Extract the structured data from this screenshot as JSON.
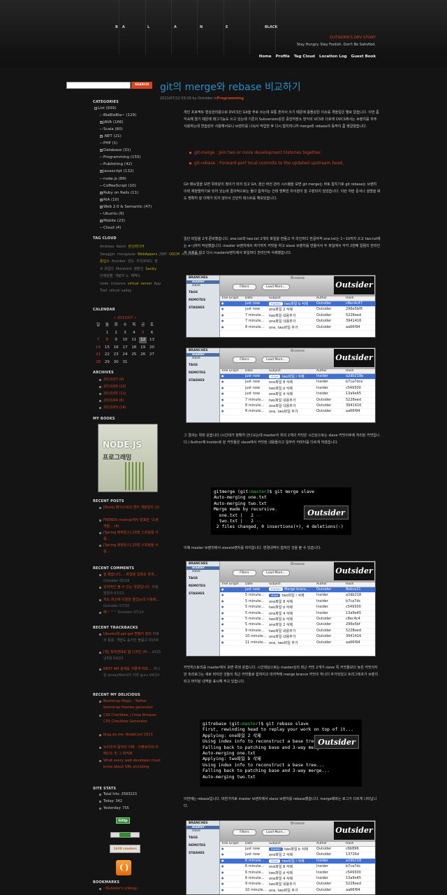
{
  "header": {
    "letters": [
      "B",
      "A",
      "L",
      "A",
      "N",
      "C",
      "E",
      "BLACK"
    ],
    "tagline_title": "OUTSIDER'S DEV STORY",
    "tagline_sub": "Stay Hungry. Stay Foolish. Don't Be Satisfied.",
    "nav": [
      "Home",
      "Profile",
      "Tag Cloud",
      "Location Log",
      "Guest Book"
    ]
  },
  "search": {
    "button": "SEARCH",
    "value": ""
  },
  "sidebar": {
    "categories_title": "CATEGORIES",
    "categories": [
      {
        "label": "List (939)",
        "toggle": "-"
      },
      {
        "label": "BlaBlaBla~ (129)"
      },
      {
        "label": "JAVA (166)",
        "toggle": "+"
      },
      {
        "label": "Scala (60)"
      },
      {
        "label": ".NET (21)",
        "toggle": "+"
      },
      {
        "label": "PHP (1)"
      },
      {
        "label": "Database (31)",
        "toggle": "+"
      },
      {
        "label": "Programming (155)"
      },
      {
        "label": "Publishing (42)"
      },
      {
        "label": "Javascript (132)",
        "toggle": "+"
      },
      {
        "label": "node.js (89)"
      },
      {
        "label": "CoffeeScript (10)"
      },
      {
        "label": "Ruby on Rails (11)",
        "toggle": "+"
      },
      {
        "label": "RIA (10)",
        "toggle": "+"
      },
      {
        "label": "Web 2.0 & Semantic (47)",
        "toggle": "+"
      },
      {
        "label": "Ubuntu (6)"
      },
      {
        "label": "Mobile (23)",
        "toggle": "+"
      },
      {
        "label": "Cloud (4)"
      }
    ],
    "tagcloud_title": "TAG CLOUD",
    "tags": [
      {
        "t": "Andreas"
      },
      {
        "t": "Katch"
      },
      {
        "t": "런닝머디어",
        "h": 1
      },
      {
        "t": "Swagger"
      },
      {
        "t": "mongoose"
      },
      {
        "t": "WebAppers",
        "h": 1
      },
      {
        "t": "JSEP"
      },
      {
        "t": "OSCM",
        "h": 1
      },
      {
        "t": "Accelerator"
      },
      {
        "t": "틀딥스",
        "h": 1
      },
      {
        "t": "Number"
      },
      {
        "t": "언도"
      },
      {
        "t": "우리코덕드"
      },
      {
        "t": "장수 유입다"
      },
      {
        "t": "MoreUnit"
      },
      {
        "t": "정환인"
      },
      {
        "t": "Sanity",
        "h": 1
      },
      {
        "t": "단례원별"
      },
      {
        "t": "개발자 노"
      },
      {
        "t": "해맥드"
      },
      {
        "t": "node"
      },
      {
        "t": "instance"
      },
      {
        "t": "virtual",
        "h": 1
      },
      {
        "t": "server",
        "h": 1
      },
      {
        "t": "App Trail"
      },
      {
        "t": "silicon valley"
      }
    ],
    "calendar_title": "CALENDAR",
    "calendar_month": "« 2013/07 »",
    "calendar_days": [
      "일",
      "월",
      "화",
      "수",
      "목",
      "금",
      "토"
    ],
    "calendar_rows": [
      [
        "",
        "1",
        "2",
        "3",
        "4",
        "5",
        "6"
      ],
      [
        "7",
        "8",
        "9",
        "10",
        "11",
        "12",
        "13"
      ],
      [
        "14",
        "15",
        "16",
        "17",
        "18",
        "19",
        "20"
      ],
      [
        "21",
        "22",
        "23",
        "24",
        "25",
        "26",
        "27"
      ],
      [
        "28",
        "29",
        "30",
        "31",
        "",
        "",
        ""
      ]
    ],
    "archives_title": "ARCHIVES",
    "archives": [
      "2013/07 (4)",
      "2013/06 (10)",
      "2013/05 (11)",
      "2013/04 (8)",
      "2013/03 (14)"
    ],
    "book_title": "MY BOOKS",
    "book_cover": {
      "title": "NODE.JS",
      "subtitle": "프로그래밍"
    },
    "recent_posts_title": "RECENT POSTS",
    "recent_posts": [
      "[Book] 페이스북의 엔지 개발일지 (2)",
      "FRENDS meetup에서 발표한 \"소셜 개발... (4)",
      "[Spring 레퍼런스] 20장 스프링을 사용...",
      "[Spring 레퍼런스] 20장 스프링을 사용..."
    ],
    "recent_comments_title": "RECENT COMMENTS",
    "recent_comments": [
      {
        "t": "잘 봤습니다.... 파일을 압축도 한개...",
        "s": "Outsider 05/18"
      },
      {
        "t": "관리자만 볼 수 있는 댓글입니다.",
        "s": "비밀방문자 07/11"
      },
      {
        "t": "저도 최근에 이끌한 들었는데 이북에...",
        "s": "Outsider 07/10"
      },
      {
        "t": "예~ ^^",
        "s": "Outsider 07/10"
      }
    ],
    "recent_trackbacks_title": "RECENT TRACKBACKS",
    "recent_trackbacks": [
      {
        "t": "Ubuntu에 apt-get 명령어 정리",
        "s": "자료와 등용. 개발도 숨겨진 볼품고 03/06"
      },
      {
        "t": "[책] 피처엔대로 웹 디자인 (Pr...",
        "s": "2020년8월 04/22"
      },
      {
        "t": "REST API 설계를 어떻게 하죠 ...",
        "s": "하나된 jerseyWorld의 자바 guru 04/10"
      }
    ],
    "recent_delicious_title": "RECENT MY DELICIOUS",
    "recent_delicious": [
      "Bootstrap Magic : Twitter bootstrap themes generator",
      "CSS Checkbox | Cross Browser CSS Checkbox Generator",
      "blog.izs.me: NodeConf 2013",
      "브라우저 동작의 이해 - 이플로우와 리페인드 및 그 최적화",
      "What every web developer must know about URL encoding"
    ],
    "site_stats_title": "SITE STATS",
    "site_stats": [
      "Total hits: 2583223",
      "Today: 342",
      "Yesterday: 755"
    ],
    "badges": [
      "Gitip",
      "1620 readers"
    ],
    "bookmarks_title": "BOOKMARKS",
    "bookmarks": [
      "::Outsider's Lifelog::"
    ]
  },
  "post": {
    "title": "git의 merge와 rebase 비교하기",
    "meta_prefix": "2011/07/12 03:29 by Outsider in",
    "meta_category": "Programming",
    "p1": "개인 프로젝트 형상관리용으로 DVCS인 Git을 주로 쓰는데 보통 혼자서 쓰기 때문에 충돌같은 이슈를 겪을일은 별로 없습니다. 이번 좀 익숙해 졌기 때문에 태그기능도 쓰고 있는데 기존의 Subversion같은 중앙저장소 방식의 VCS와 다르게 DVCS에서는 브랜치를 자주 사용하는데 연습삼아 사용해서보니 브랜치를 나눠서 작업한 후 다시 합치려니까 merge와 rebase의 동작이 좀 햇갈렸습니다.",
    "list": [
      "git-merge : Join two or more development histories together.",
      "git-rebase : Forward-port local commits to the updated upstream head."
    ],
    "p2": "Git 매뉴얼을 보면 위와같이 정의가 되어 있고 Git, 분산 버전 관리 시스템을 보면 git merge는 바로 합치기로 git rebase는 브랜치 이력 재정렬하기로 되어 있는데 결과적으로는 둘다 합쳐지는 건데 명확한 차이점이 잘 구분되지 않았습니다. 이런 저런 문서나 설명을 봐도 명확히 잘 이해가 되지 않아서 간단히 테스트를 해보았습니다.",
    "p3": "일단 파일을 2개 준비했습니다. one.txt와 two.txt 2개의 파일을 만들고 각 라인마다 한글자씩 one.txt는 1~10까지 쓰고 two.txt에는 a~j까지 작성했습니다. master 브랜치에서 여기까지 커밋을 하고 slave 브랜치를 만들어서 두 파일에서 각각 2번째 칼럼의 한라인씩 삭제를 하고 다시 master브랜치에서 파일마다 한라인씩 삭제했습니다.",
    "p4": "그 결과는 위와 같습니다.(시간대가 정확히 안나오는데 master의 위의 2개의 커밋은 시간순으로는 slave 커밋이후에 처리된 커밋입니다.) Author에 Insider로 된 커밋들은 slave에서 커밋된 내용들이고 일부러 커미터를 다르게 하였습니다.",
    "p5": "이제 master 브랜치에서 slave브랜치를 머지합니다. 변경내역이 합쳐진 것을 볼 수 있습니다.",
    "p6": "커밋히스토리를 master에서 보면 위와 같습니다. 시간대상으로는 master상의 최근 커밋 2개가 slave 쪽 커밋들보다 늦은 커밋이지만 트리로그는 새로 머지한 것들이 최근 커밋들로 합쳐지고 마지막에 merge brance 커밋이 하나더 추가되었고 트리그래프가 브랜치되고 머지된 내역을 표시해 주고 있습니다.",
    "p7": "이번에는 rebase입니다. 마찬가지로 master 브랜치에서 slave 브랜치를 rebase했습니다. merge때와는 로그가 다르게 나타납니다.",
    "gitx": {
      "title": "Browse",
      "filters": "Filters",
      "loadmore": "Load More...",
      "logo": "Outsider",
      "branches": "BRANCHES",
      "tags": "TAGS",
      "remotes": "REMOTES",
      "stashes": "STASHES",
      "cols": [
        "Tree Graph",
        "Date",
        "Subject",
        "Author",
        "Hash"
      ]
    },
    "shot1": {
      "branches": [
        "master",
        "slave"
      ],
      "rows": [
        [
          "just now",
          "master",
          "two파일 b 삭제",
          "Outsider",
          "c8ec4c47",
          1
        ],
        [
          "just now",
          "",
          "one파일 2 삭제",
          "Outsider",
          "296e5bf6"
        ],
        [
          "7 minute...",
          "",
          "two파일 내용추가",
          "Outsider",
          "5228eed"
        ],
        [
          "7 minute...",
          "",
          "one파일 내용추가",
          "Outsider",
          "3941416"
        ],
        [
          "8 minute...",
          "",
          "one, two파일 추가",
          "Outsider",
          "aa66f94"
        ]
      ]
    },
    "shot2": {
      "branches": [
        "master",
        "slave"
      ],
      "rows": [
        [
          "just now",
          "slave",
          "two파일 i 삭제",
          "Insider",
          "a2db218e",
          1
        ],
        [
          "just now",
          "",
          "one파일 8 삭제",
          "Insider",
          "b7ca7dce"
        ],
        [
          "just now",
          "",
          "two파일 d 삭제",
          "Insider",
          "c549300"
        ],
        [
          "just now",
          "",
          "one파일 4 삭제",
          "Insider",
          "13a9e45"
        ],
        [
          "7 minute...",
          "",
          "two파일 내용추가",
          "Outsider",
          "5228eed"
        ],
        [
          "8 minute...",
          "",
          "one파일 내용추가",
          "Outsider",
          "3941416"
        ],
        [
          "8 minute...",
          "",
          "one, two파일 추가",
          "Outsider",
          "aa66f94"
        ]
      ]
    },
    "shot3": {
      "branches": [
        "master",
        "slave"
      ],
      "rows": [
        [
          "just now",
          "master",
          "Merge branc...",
          "Outsider",
          "8ebca21",
          1
        ],
        [
          "5 minute...",
          "slave",
          "two파일 i 삭제",
          "Insider",
          "a2db218"
        ],
        [
          "5 minute...",
          "",
          "one파일 8 삭제",
          "Insider",
          "b7ca7dc"
        ],
        [
          "5 minute...",
          "",
          "two파일 d 삭제",
          "Insider",
          "c549300"
        ],
        [
          "5 minute...",
          "",
          "one파일 4 삭제",
          "Insider",
          "13a9e45"
        ],
        [
          "5 minute...",
          "",
          "two파일 b 삭제",
          "Outsider",
          "c8ec4c4"
        ],
        [
          "5 minute...",
          "",
          "one파일 2 삭제",
          "Outsider",
          "296e5bf"
        ],
        [
          "9 minute...",
          "",
          "two파일 내용추가",
          "Outsider",
          "5228eed"
        ],
        [
          "10 minute...",
          "",
          "one파일 내용추가",
          "Outsider",
          "3941416"
        ],
        [
          "11 minute...",
          "",
          "one, two파일 추가",
          "Outsider",
          "aa66f94"
        ]
      ]
    },
    "shot4": {
      "branches": [
        "master",
        "slave"
      ],
      "rows": [
        [
          "just now",
          "master",
          "two파일 b 삭제",
          "Outsider",
          "c6b896"
        ],
        [
          "just now",
          "",
          "one파일 2 삭제",
          "Outsider",
          "13726d"
        ],
        [
          "6 minute...",
          "slave",
          "two파일 i 삭제",
          "Insider",
          "a2db218",
          1
        ],
        [
          "6 minute...",
          "",
          "one파일 8 삭제",
          "Insider",
          "b7ca7dc"
        ],
        [
          "6 minute...",
          "",
          "two파일 d 삭제",
          "Insider",
          "c549300"
        ],
        [
          "6 minute...",
          "",
          "one파일 4 삭제",
          "Insider",
          "13a9e45"
        ],
        [
          "9 minute...",
          "",
          "two파일 내용추가",
          "Outsider",
          "5228eed"
        ],
        [
          "10 minute...",
          "",
          "one, two파일 추가",
          "Outsider",
          "aa66f94"
        ]
      ]
    },
    "term1": {
      "prompt": "gitmerge (git:",
      "branch": "master",
      "cmd": ")$ git merge slave",
      "lines": [
        "Auto-merging one.txt",
        "Auto-merging two.txt",
        "Merge made by recursive.",
        "  one.txt |   2 ",
        "  two.txt |   2 ",
        " 2 files changed, 0 insertions(+), 4 deletions(-)"
      ],
      "minus": "--"
    },
    "term2": {
      "prompt": "gitrebase (git:",
      "branch": "master",
      "cmd": ")$ git rebase slave",
      "lines": [
        "First, rewinding head to replay your work on top of it...",
        "Applying: one파일 2 삭제",
        "Using index info to reconstruct a base tree...",
        "Falling back to patching base and 3-way merge...",
        "Auto-merging one.txt",
        "Applying: two파일 b 삭제",
        "Using index info to reconstruct a base tree...",
        "Falling back to patching base and 3-way merge...",
        "Auto-merging two.txt"
      ]
    }
  }
}
